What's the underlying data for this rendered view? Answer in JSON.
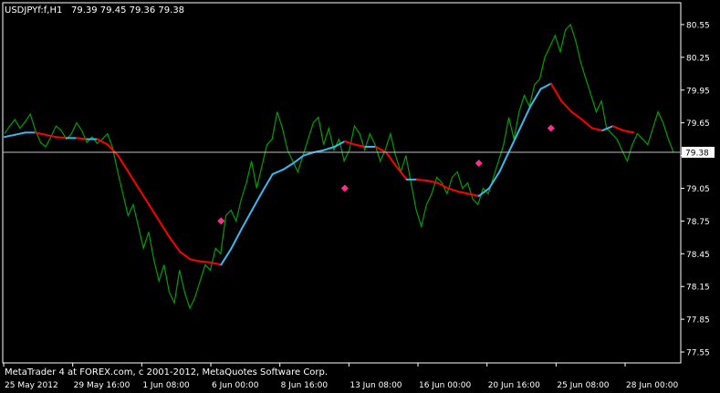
{
  "header": {
    "symbol": "USDJPYf:f,H1",
    "ohlc": "79.39 79.45 79.36 79.38"
  },
  "footer": {
    "copyright": "MetaTrader 4 at FOREX.com, c 2001-2012, MetaQuotes Software Corp."
  },
  "colors": {
    "background": "#000000",
    "price": "#00a000",
    "ma_down": "#ff0000",
    "ma_up": "#3cb8f0",
    "signal": "#ff2d8f",
    "frame": "#ffffff",
    "current_price_line": "#c0c0c0"
  },
  "chart_data": {
    "type": "line",
    "title": "USDJPYf:f,H1",
    "ylim": [
      77.45,
      80.75
    ],
    "x_ticks": [
      "25 May 2012",
      "29 May 16:00",
      "1 Jun 08:00",
      "6 Jun 00:00",
      "8 Jun 16:00",
      "13 Jun 08:00",
      "16 Jun 00:00",
      "20 Jun 16:00",
      "25 Jun 08:00",
      "28 Jun 00:00"
    ],
    "y_ticks": [
      80.55,
      80.25,
      79.95,
      79.65,
      79.35,
      79.05,
      78.75,
      78.45,
      78.15,
      77.85,
      77.55
    ],
    "current_price": 79.38,
    "series": [
      {
        "type": "line",
        "values": [
          79.55,
          79.62,
          79.68,
          79.6,
          79.66,
          79.73,
          79.58,
          79.47,
          79.43,
          79.52,
          79.62,
          79.58,
          79.5,
          79.55,
          79.65,
          79.58,
          79.47,
          79.52,
          79.46,
          79.5,
          79.55,
          79.42,
          79.2,
          79.0,
          78.8,
          78.9,
          78.7,
          78.5,
          78.65,
          78.4,
          78.2,
          78.35,
          78.1,
          78.0,
          78.3,
          78.1,
          77.95,
          78.05,
          78.2,
          78.35,
          78.3,
          78.5,
          78.45,
          78.8,
          78.85,
          78.75,
          78.95,
          79.1,
          79.3,
          79.05,
          79.25,
          79.45,
          79.5,
          79.75,
          79.6,
          79.4,
          79.3,
          79.2,
          79.35,
          79.5,
          79.65,
          79.7,
          79.45,
          79.6,
          79.4,
          79.5,
          79.3,
          79.4,
          79.62,
          79.55,
          79.4,
          79.55,
          79.45,
          79.3,
          79.4,
          79.55,
          79.35,
          79.2,
          79.35,
          79.1,
          78.85,
          78.7,
          78.9,
          79.0,
          79.15,
          79.1,
          79.0,
          79.15,
          79.2,
          79.05,
          79.1,
          78.95,
          78.9,
          79.05,
          79.0,
          79.15,
          79.3,
          79.45,
          79.7,
          79.5,
          79.75,
          79.9,
          79.8,
          80.0,
          80.05,
          80.25,
          80.35,
          80.45,
          80.3,
          80.5,
          80.55,
          80.4,
          80.2,
          80.05,
          79.9,
          79.75,
          79.85,
          79.6,
          79.55,
          79.5,
          79.4,
          79.3,
          79.45,
          79.55,
          79.5,
          79.45,
          79.6,
          79.75,
          79.65,
          79.5,
          79.38
        ]
      },
      {
        "type": "line",
        "values": [
          79.52,
          79.54,
          79.56,
          79.56,
          79.54,
          79.52,
          79.51,
          79.51,
          79.5,
          79.5,
          79.45,
          79.35,
          79.2,
          79.05,
          78.9,
          78.75,
          78.6,
          78.47,
          78.4,
          78.38,
          78.37,
          78.35,
          78.5,
          78.68,
          78.85,
          79.02,
          79.18,
          79.22,
          79.28,
          79.35,
          79.38,
          79.4,
          79.43,
          79.48,
          79.45,
          79.43,
          79.43,
          79.38,
          79.25,
          79.13,
          79.13,
          79.12,
          79.1,
          79.05,
          79.02,
          79.0,
          78.98,
          79.05,
          79.2,
          79.4,
          79.6,
          79.8,
          79.96,
          80.01,
          79.85,
          79.75,
          79.68,
          79.6,
          79.58,
          79.62,
          79.58,
          79.56
        ]
      }
    ],
    "signals": [
      78.75,
      79.05,
      79.28,
      79.6
    ]
  }
}
